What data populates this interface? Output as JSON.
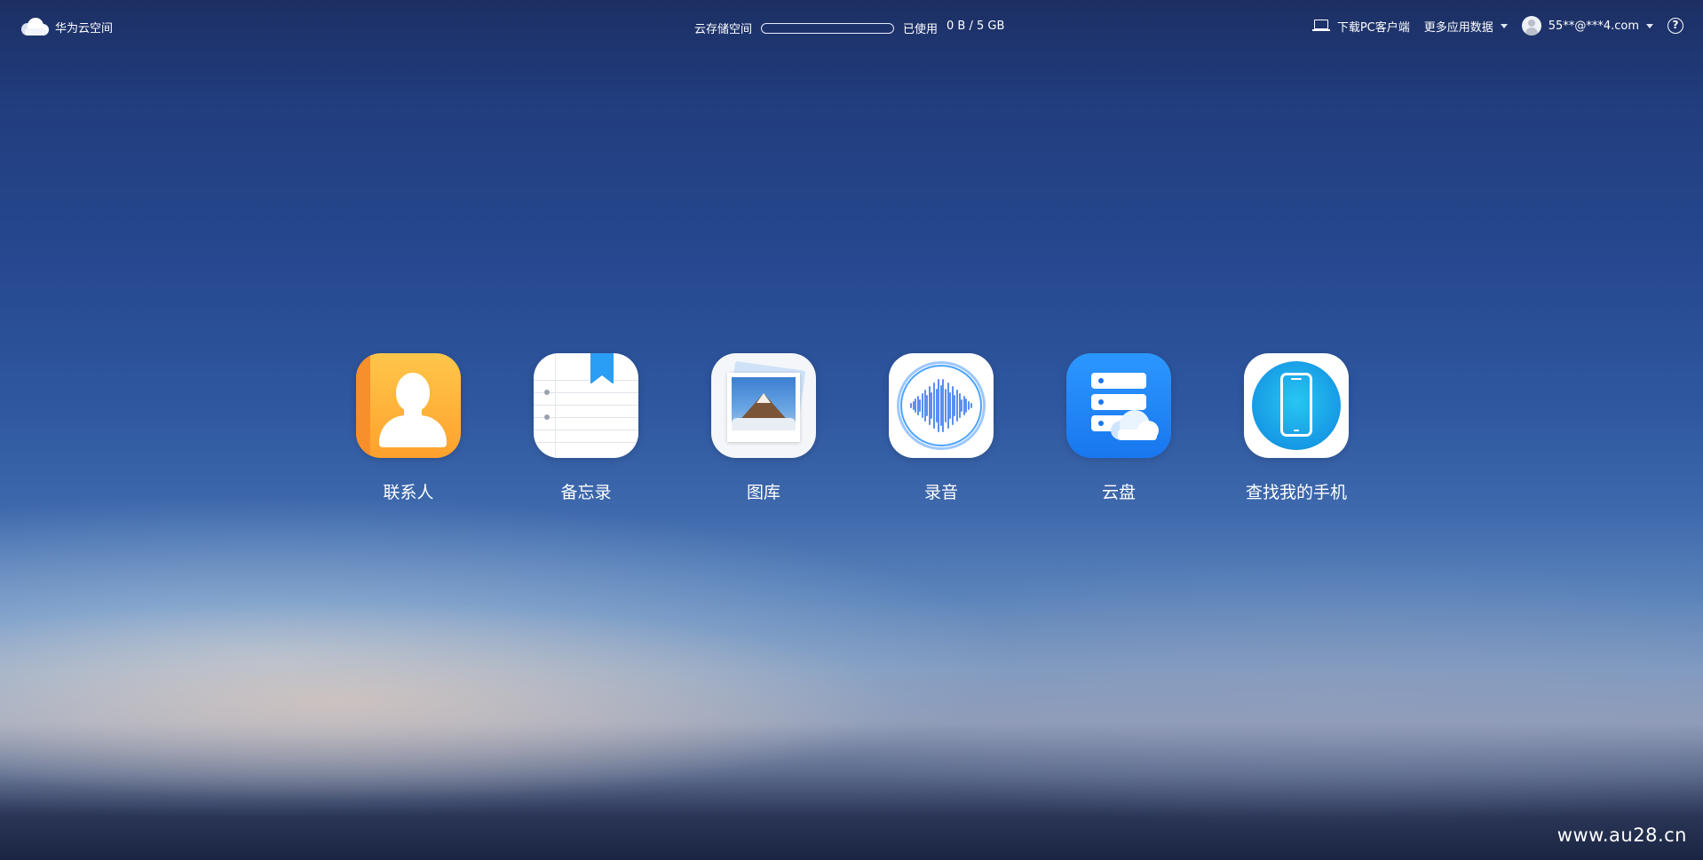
{
  "header": {
    "brand": "华为云空间",
    "storage_label": "云存储空间",
    "storage_used_label": "已使用",
    "storage_used_value": "0 B / 5 GB",
    "storage_fill_fraction": 0,
    "download_pc": "下载PC客户端",
    "more_data": "更多应用数据",
    "account": "55**@***4.com",
    "help": "?"
  },
  "apps": [
    {
      "label": "联系人",
      "icon": "contacts-icon"
    },
    {
      "label": "备忘录",
      "icon": "notes-icon"
    },
    {
      "label": "图库",
      "icon": "gallery-icon"
    },
    {
      "label": "录音",
      "icon": "recorder-icon"
    },
    {
      "label": "云盘",
      "icon": "cloud-drive-icon"
    },
    {
      "label": "查找我的手机",
      "icon": "find-phone-icon"
    }
  ],
  "watermark": "www.au28.cn",
  "colors": {
    "background_top": "#1c2f63",
    "background_mid": "#2f58a0",
    "contacts_accent": "#ffa12c",
    "drive_accent": "#1877ef",
    "find_phone_accent": "#0e86df"
  }
}
